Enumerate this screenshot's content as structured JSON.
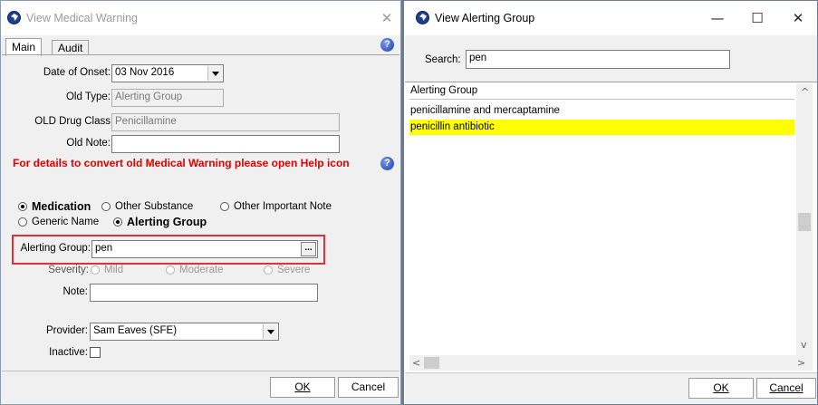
{
  "medical_warning": {
    "title": "View Medical Warning",
    "close": "✕",
    "tabs": [
      "Main",
      "Audit"
    ],
    "help": "?",
    "date_of_onset": {
      "label": "Date of Onset:",
      "value": "03 Nov 2016"
    },
    "old_type": {
      "label": "Old Type:",
      "value": "Alerting Group"
    },
    "old_drug_class": {
      "label": "OLD Drug Class",
      "value": "Penicillamine"
    },
    "old_note": {
      "label": "Old Note:",
      "value": ""
    },
    "warning_text": "For details to convert old Medical Warning please open Help icon",
    "radios_row1": [
      "Medication",
      "Other Substance",
      "Other Important Note"
    ],
    "radios_row2": [
      "Generic Name",
      "Alerting Group"
    ],
    "alerting_group": {
      "label": "Alerting Group:",
      "value": "pen",
      "browse": "..."
    },
    "severity": {
      "label": "Severity:",
      "options": [
        "Mild",
        "Moderate",
        "Severe"
      ]
    },
    "note": {
      "label": "Note:",
      "value": ""
    },
    "provider": {
      "label": "Provider:",
      "value": "Sam Eaves (SFE)"
    },
    "inactive": {
      "label": "Inactive:",
      "checked": false
    },
    "ok_label": "OK",
    "cancel_label": "Cancel"
  },
  "alerting_group_dialog": {
    "title": "View Alerting Group",
    "minimize": "—",
    "maximize": "☐",
    "close": "✕",
    "search": {
      "label": "Search:",
      "value": "pen"
    },
    "column_header": "Alerting Group",
    "rows": [
      "penicillamine and mercaptamine",
      "penicillin antibiotic"
    ],
    "selected_row": 1,
    "selection_color": "#ffff00",
    "ok_label": "OK",
    "cancel_label": "Cancel"
  }
}
